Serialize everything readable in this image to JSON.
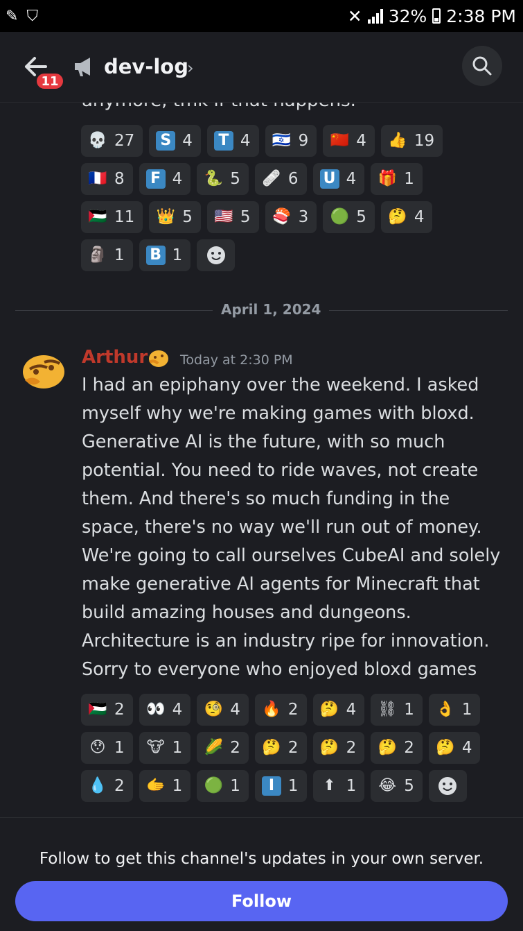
{
  "status_bar": {
    "battery": "32%",
    "time": "2:38 PM"
  },
  "header": {
    "channel_name": "dev-log",
    "unread_badge": "11"
  },
  "previous_message": {
    "tail_text": "anymore, tmk if that happens."
  },
  "reactions_top": [
    {
      "emoji": "💀",
      "count": "27"
    },
    {
      "emoji": "S",
      "count": "4"
    },
    {
      "emoji": "T",
      "count": "4"
    },
    {
      "emoji": "🇮🇱",
      "count": "9"
    },
    {
      "emoji": "🇨🇳",
      "count": "4"
    },
    {
      "emoji": "👍",
      "count": "19"
    },
    {
      "emoji": "🇫🇷",
      "count": "8"
    },
    {
      "emoji": "F",
      "count": "4"
    },
    {
      "emoji": "🐍",
      "count": "5"
    },
    {
      "emoji": "🩹",
      "count": "6"
    },
    {
      "emoji": "U",
      "count": "4"
    },
    {
      "emoji": "🎁",
      "count": "1"
    },
    {
      "emoji": "🇵🇸",
      "count": "11"
    },
    {
      "emoji": "👑",
      "count": "5"
    },
    {
      "emoji": "🇺🇸",
      "count": "5"
    },
    {
      "emoji": "🍣",
      "count": "3"
    },
    {
      "emoji": "🟢",
      "count": "5"
    },
    {
      "emoji": "🤔",
      "count": "4"
    },
    {
      "emoji": "🗿",
      "count": "1"
    },
    {
      "emoji": "B",
      "count": "1"
    }
  ],
  "date_divider": "April 1, 2024",
  "message": {
    "author": "Arthur",
    "timestamp": "Today at 2:30 PM",
    "text": "I had an epiphany over the weekend. I asked myself why we're making games with bloxd. Generative AI is the future, with so much potential. You need to ride waves, not create them. And there's so much funding in the space, there's no way we'll run out of money. We're going to call ourselves CubeAI and solely make generative AI agents for Minecraft that build amazing houses and dungeons. Architecture is an industry ripe for innovation. Sorry to everyone who enjoyed bloxd games"
  },
  "reactions_bottom": [
    {
      "emoji": "🇵🇸",
      "count": "2"
    },
    {
      "emoji": "👀",
      "count": "4"
    },
    {
      "emoji": "🧐",
      "count": "4"
    },
    {
      "emoji": "🔥",
      "count": "2"
    },
    {
      "emoji": "🤔",
      "count": "4"
    },
    {
      "emoji": "⛓",
      "count": "1"
    },
    {
      "emoji": "👌",
      "count": "1"
    },
    {
      "emoji": "😯",
      "count": "1"
    },
    {
      "emoji": "🐮",
      "count": "1"
    },
    {
      "emoji": "🌽",
      "count": "2"
    },
    {
      "emoji": "🤔",
      "count": "2"
    },
    {
      "emoji": "🤔",
      "count": "2"
    },
    {
      "emoji": "🤔",
      "count": "2"
    },
    {
      "emoji": "🤔",
      "count": "4"
    },
    {
      "emoji": "💧",
      "count": "2"
    },
    {
      "emoji": "🫱",
      "count": "1"
    },
    {
      "emoji": "🟢",
      "count": "1"
    },
    {
      "emoji": "I",
      "count": "1"
    },
    {
      "emoji": "⬆",
      "count": "1"
    },
    {
      "emoji": "😂",
      "count": "5"
    }
  ],
  "footer": {
    "prompt": "Follow to get this channel's updates in your own server.",
    "follow_label": "Follow"
  },
  "colors": {
    "accent": "#5865f2",
    "badge": "#e5393f",
    "author": "#c0392b",
    "letter_emoji": "#3b88c3"
  }
}
